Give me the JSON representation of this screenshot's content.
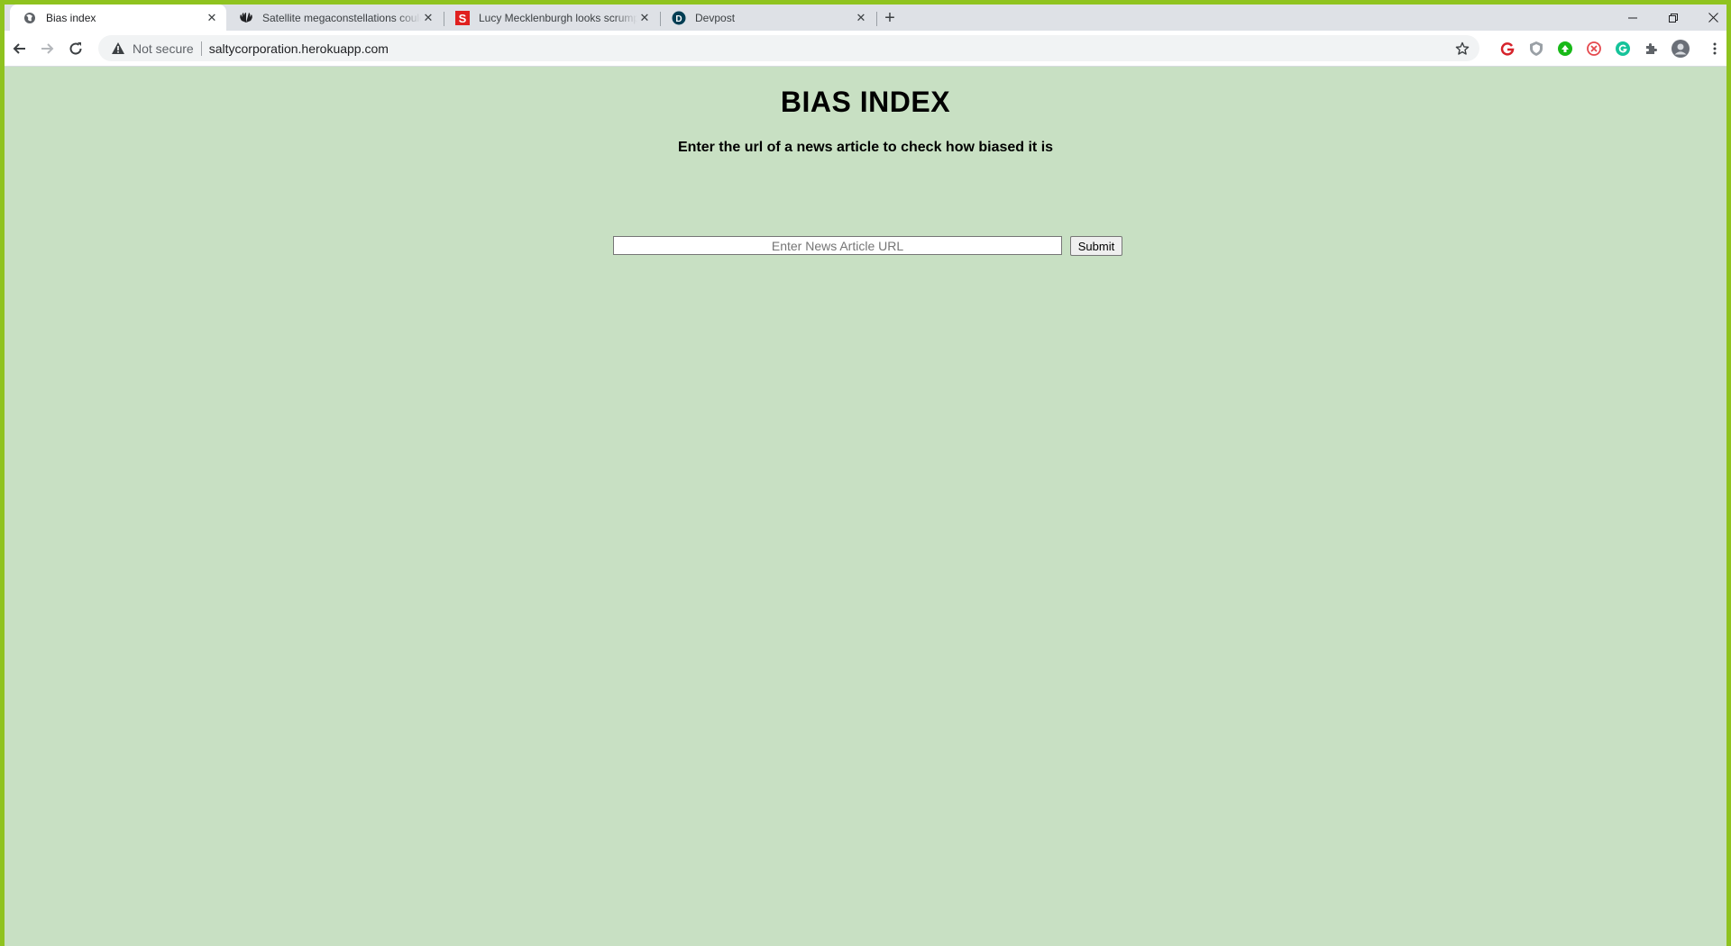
{
  "browser": {
    "tabs": [
      {
        "title": "Bias index",
        "active": true,
        "favicon": "globe-icon"
      },
      {
        "title": "Satellite megaconstellations could",
        "active": false,
        "favicon": "nbc-peacock-icon"
      },
      {
        "title": "Lucy Mecklenburgh looks scrump",
        "active": false,
        "favicon": "sun-s-icon"
      },
      {
        "title": "Devpost",
        "active": false,
        "favicon": "devpost-d-icon"
      }
    ],
    "new_tab_label": "+",
    "address_bar": {
      "security_label": "Not secure",
      "url": "saltycorporation.herokuapp.com"
    },
    "colors": {
      "window_frame": "#8fc31f",
      "page_background": "#c8e0c3"
    }
  },
  "page": {
    "title": "BIAS INDEX",
    "subtitle": "Enter the url of a news article to check how biased it is",
    "form": {
      "url_input_placeholder": "Enter News Article URL",
      "url_input_value": "",
      "submit_label": "Submit"
    }
  }
}
